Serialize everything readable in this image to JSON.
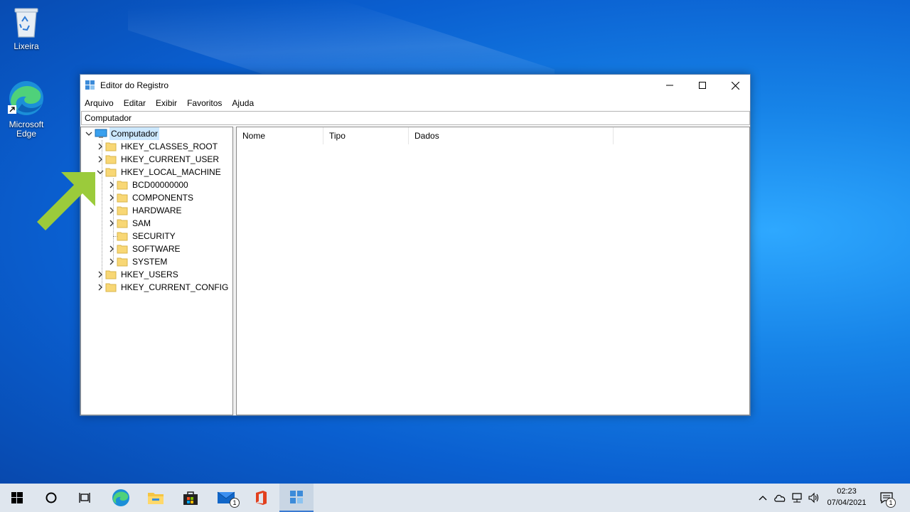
{
  "desktop": {
    "icons": [
      {
        "label": "Lixeira",
        "icon": "recycle-bin-icon"
      },
      {
        "label": "Microsoft Edge",
        "icon": "edge-icon"
      }
    ]
  },
  "window": {
    "title": "Editor do Registro",
    "menu": [
      "Arquivo",
      "Editar",
      "Exibir",
      "Favoritos",
      "Ajuda"
    ],
    "address": "Computador",
    "tree": {
      "root": "Computador",
      "hives": [
        "HKEY_CLASSES_ROOT",
        "HKEY_CURRENT_USER",
        "HKEY_LOCAL_MACHINE",
        "HKEY_USERS",
        "HKEY_CURRENT_CONFIG"
      ],
      "hklm_children": [
        "BCD00000000",
        "COMPONENTS",
        "HARDWARE",
        "SAM",
        "SECURITY",
        "SOFTWARE",
        "SYSTEM"
      ]
    },
    "columns": [
      "Nome",
      "Tipo",
      "Dados"
    ]
  },
  "taskbar": {
    "badges": {
      "mail": "1",
      "notifications": "1"
    },
    "time": "02:23",
    "date": "07/04/2021"
  },
  "colors": {
    "arrow": "#9bcb3b",
    "selection": "#cce8ff",
    "folder": "#f8d775"
  }
}
